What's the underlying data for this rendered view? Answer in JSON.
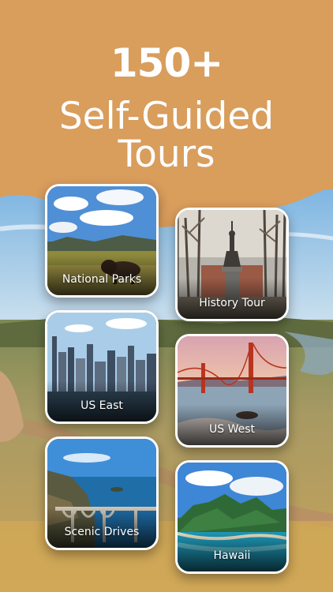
{
  "headline": {
    "count": "150+",
    "line1": "Self-Guided",
    "line2": "Tours"
  },
  "colors": {
    "header_background": "#d99d5c",
    "text": "#ffffff",
    "card_border": "#ffffff"
  },
  "tour_categories": [
    {
      "label": "National Parks",
      "image": "bison-prairie-photo"
    },
    {
      "label": "History Tour",
      "image": "statue-park-photo"
    },
    {
      "label": "US East",
      "image": "city-skyline-photo"
    },
    {
      "label": "US West",
      "image": "golden-gate-bridge-photo"
    },
    {
      "label": "Scenic Drives",
      "image": "coastal-bridge-photo"
    },
    {
      "label": "Hawaii",
      "image": "tropical-island-photo"
    }
  ]
}
